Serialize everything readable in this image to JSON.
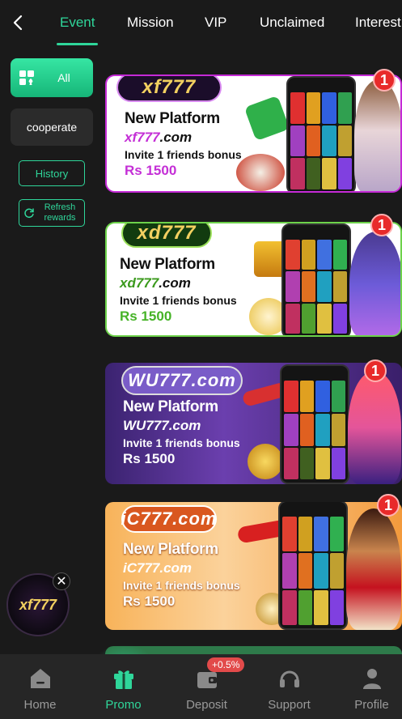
{
  "tabs": [
    {
      "label": "Event",
      "active": true
    },
    {
      "label": "Mission"
    },
    {
      "label": "VIP"
    },
    {
      "label": "Unclaimed"
    },
    {
      "label": "Interest"
    }
  ],
  "sidebar": {
    "all_label": "All",
    "cooperate_label": "cooperate",
    "history_label": "History",
    "refresh_label_1": "Refresh",
    "refresh_label_2": "rewards"
  },
  "banners": [
    {
      "logo": "xf777",
      "headline": "New Platform",
      "domain_brand": "xf777",
      "domain_suffix": ".com",
      "invite": "Invite 1 friends bonus",
      "bonus": "Rs 1500",
      "badge": "1"
    },
    {
      "logo": "xd777",
      "headline": "New Platform",
      "domain_brand": "xd777",
      "domain_suffix": ".com",
      "invite": "Invite 1 friends bonus",
      "bonus": "Rs 1500",
      "badge": "1"
    },
    {
      "logo": "WU777.com",
      "headline": "New Platform",
      "domain_brand": "WU777",
      "domain_suffix": ".com",
      "invite": "Invite 1 friends bonus",
      "bonus": "Rs 1500",
      "badge": "1"
    },
    {
      "logo": "iC777.com",
      "headline": "New Platform",
      "domain_brand": "iC777",
      "domain_suffix": ".com",
      "invite": "Invite 1 friends bonus",
      "bonus": "Rs 1500",
      "badge": "1"
    }
  ],
  "floating_ad": {
    "logo": "xf777"
  },
  "bottom_nav": [
    {
      "label": "Home",
      "icon": "home-icon"
    },
    {
      "label": "Promo",
      "icon": "gift-icon",
      "active": true
    },
    {
      "label": "Deposit",
      "icon": "wallet-icon",
      "badge": "+0.5%"
    },
    {
      "label": "Support",
      "icon": "headset-icon"
    },
    {
      "label": "Profile",
      "icon": "user-icon"
    }
  ],
  "colors": {
    "accent": "#2fd69a",
    "background": "#1a1a1a",
    "badge_red": "#e82a2a"
  }
}
